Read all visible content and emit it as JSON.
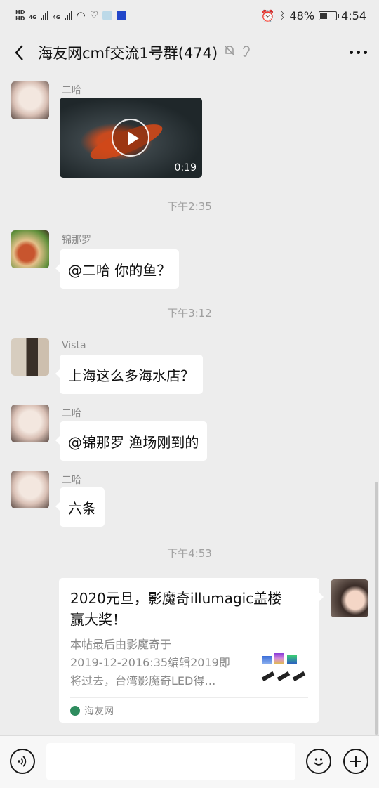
{
  "status_bar": {
    "left_badges": [
      "HD",
      "HD"
    ],
    "net1": "4G",
    "net2": "4G",
    "battery_percent": "48%",
    "battery_level": 0.48,
    "time": "4:54"
  },
  "header": {
    "title": "海友网cmf交流1号群(474)"
  },
  "messages": [
    {
      "sender": "二哈"
    },
    {
      "sender": "锦那罗",
      "text": "@二哈  你的鱼？"
    },
    {
      "sender": "Vista",
      "text": "上海这么多海水店？"
    },
    {
      "sender": "二哈",
      "text": "@锦那罗 渔场刚到的"
    },
    {
      "sender": "二哈",
      "text": "六条"
    }
  ],
  "video": {
    "duration": "0:19"
  },
  "times": [
    "下午2:35",
    "下午3:12",
    "下午4:53"
  ],
  "link_card": {
    "title_line1": "2020元旦，影魔奇illumagic盖楼",
    "title_line2": "赢大奖！",
    "desc_line1": "本帖最后由影魔奇于",
    "desc_line2": "2019-12-2016:35编辑2019即",
    "desc_line3": "将过去，台湾影魔奇LED得…",
    "source": "海友网"
  },
  "colors": {
    "background": "#ededed",
    "bubble": "#ffffff",
    "source_icon": "#2e8c5e"
  }
}
